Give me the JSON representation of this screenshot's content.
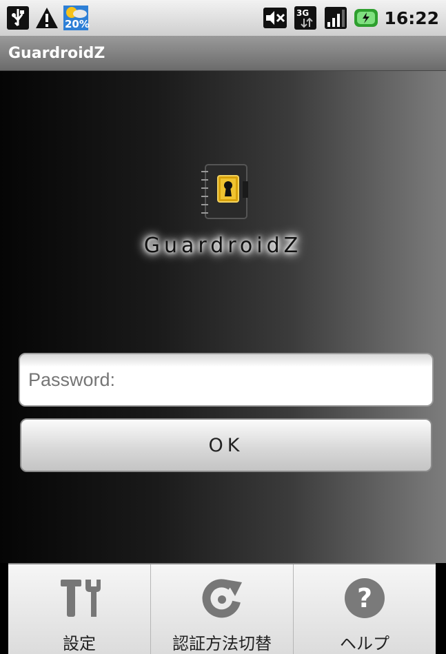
{
  "status_bar": {
    "left_icons": [
      "usb-icon",
      "warning-icon",
      "weather-icon"
    ],
    "weather_badge": "20%",
    "right_icons": [
      "mute-icon",
      "3g-data-icon",
      "signal-icon",
      "battery-charging-icon"
    ],
    "time": "16:22"
  },
  "title_bar": {
    "title": "GuardroidZ"
  },
  "logo": {
    "text": "GuardroidZ",
    "icon": "notebook-lock-icon"
  },
  "password": {
    "placeholder": "Password:",
    "value": ""
  },
  "ok_button": {
    "label": "OK"
  },
  "menu": {
    "items": [
      {
        "label": "設定",
        "icon": "tools-icon"
      },
      {
        "label": "認証方法切替",
        "icon": "refresh-icon"
      },
      {
        "label": "ヘルプ",
        "icon": "help-icon"
      }
    ]
  },
  "colors": {
    "status_bar_bg": "#dcdcdc",
    "title_bar_bg": "#808080",
    "menu_bg": "#e9e9e9",
    "battery_green": "#3bb53b"
  }
}
